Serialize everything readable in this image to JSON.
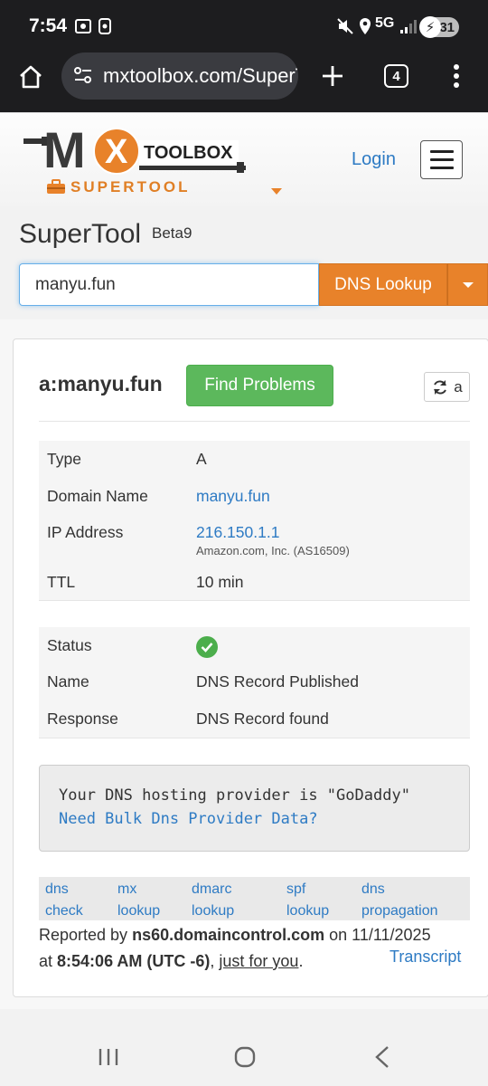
{
  "status_bar": {
    "time": "7:54",
    "network": "5G",
    "battery": "31"
  },
  "browser": {
    "url": "mxtoolbox.com/SuperTool",
    "tab_count": "4"
  },
  "header": {
    "logo_text": "TOOLBOX",
    "logo_brand": "MX",
    "supertool_label": "SUPERTOOL",
    "login_label": "Login"
  },
  "supertool": {
    "title": "SuperTool",
    "beta": "Beta9",
    "search_value": "manyu.fun",
    "lookup_label": "DNS Lookup"
  },
  "result": {
    "title": "a:manyu.fun",
    "find_problems_label": "Find Problems",
    "refresh_suffix": "a",
    "record": [
      {
        "key": "Type",
        "value": "A"
      },
      {
        "key": "Domain Name",
        "value": "manyu.fun"
      },
      {
        "key": "IP Address",
        "value": "216.150.1.1",
        "sub": "Amazon.com, Inc. (AS16509)"
      },
      {
        "key": "TTL",
        "value": "10 min"
      }
    ],
    "status": [
      {
        "key": "Status",
        "value": ""
      },
      {
        "key": "Name",
        "value": "DNS Record Published"
      },
      {
        "key": "Response",
        "value": "DNS Record found"
      }
    ],
    "provider_line": "Your DNS hosting provider is \"GoDaddy\"",
    "provider_link": "Need Bulk Dns Provider Data?",
    "tools": [
      {
        "line1": "dns",
        "line2": "check"
      },
      {
        "line1": "mx",
        "line2": "lookup"
      },
      {
        "line1": "dmarc",
        "line2": "lookup"
      },
      {
        "line1": "spf",
        "line2": "lookup"
      },
      {
        "line1": "dns",
        "line2": "propagation"
      }
    ],
    "reported_prefix": "Reported by",
    "reported_server": "ns60.domaincontrol.com",
    "reported_on": "on 11/11/2025",
    "reported_at": "at",
    "reported_time": "8:54:06 AM (UTC -6)",
    "reported_for": "just for you",
    "transcript_label": "Transcript"
  },
  "colors": {
    "accent_orange": "#e8822a",
    "success_green": "#5cb85c",
    "link_blue": "#2e7bc4"
  }
}
